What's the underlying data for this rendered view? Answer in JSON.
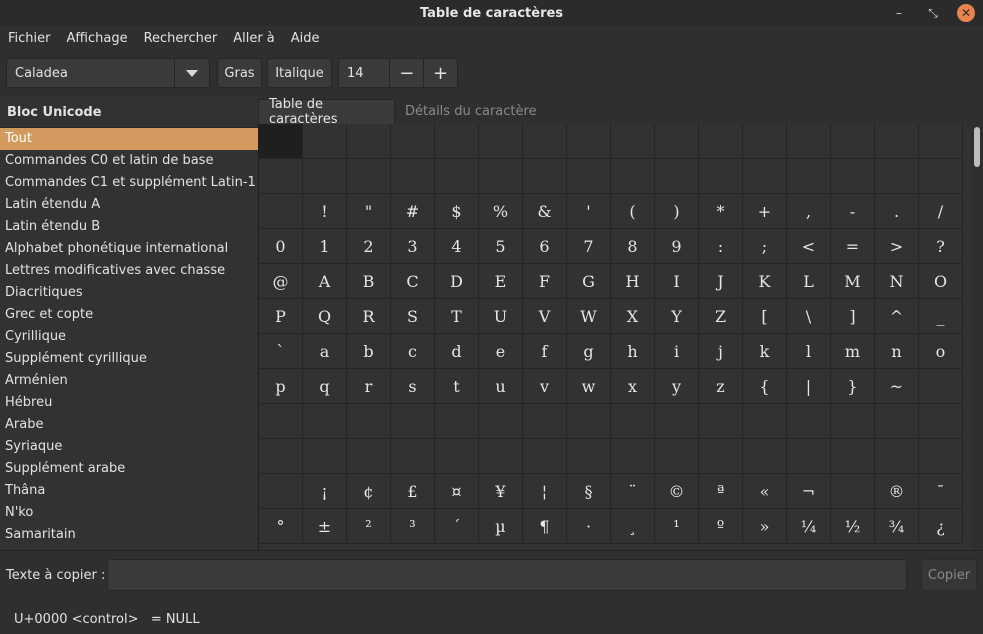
{
  "window": {
    "title": "Table de caractères"
  },
  "menu": [
    "Fichier",
    "Affichage",
    "Rechercher",
    "Aller à",
    "Aide"
  ],
  "toolbar": {
    "font": "Caladea",
    "bold_label": "Gras",
    "italic_label": "Italique",
    "size": "14",
    "minus_label": "−",
    "plus_label": "+"
  },
  "sidebar": {
    "header": "Bloc Unicode",
    "items": [
      "Tout",
      "Commandes C0 et latin de base",
      "Commandes C1 et supplément Latin-1",
      "Latin étendu A",
      "Latin étendu B",
      "Alphabet phonétique international",
      "Lettres modificatives avec chasse",
      "Diacritiques",
      "Grec et copte",
      "Cyrillique",
      "Supplément cyrillique",
      "Arménien",
      "Hébreu",
      "Arabe",
      "Syriaque",
      "Supplément arabe",
      "Thâna",
      "N'ko",
      "Samaritain"
    ],
    "selected_index": 0
  },
  "tabs": [
    "Table de caractères",
    "Détails du caractère"
  ],
  "grid": {
    "rows": [
      [
        "",
        "",
        "",
        "",
        "",
        "",
        "",
        "",
        "",
        "",
        "",
        "",
        "",
        "",
        "",
        ""
      ],
      [
        "",
        "",
        "",
        "",
        "",
        "",
        "",
        "",
        "",
        "",
        "",
        "",
        "",
        "",
        "",
        ""
      ],
      [
        "",
        "!",
        "\"",
        "#",
        "$",
        "%",
        "&",
        "'",
        "(",
        ")",
        "*",
        "+",
        ",",
        "-",
        ".",
        "/"
      ],
      [
        "0",
        "1",
        "2",
        "3",
        "4",
        "5",
        "6",
        "7",
        "8",
        "9",
        ":",
        ";",
        "<",
        "=",
        ">",
        "?"
      ],
      [
        "@",
        "A",
        "B",
        "C",
        "D",
        "E",
        "F",
        "G",
        "H",
        "I",
        "J",
        "K",
        "L",
        "M",
        "N",
        "O"
      ],
      [
        "P",
        "Q",
        "R",
        "S",
        "T",
        "U",
        "V",
        "W",
        "X",
        "Y",
        "Z",
        "[",
        "\\",
        "]",
        "^",
        "_"
      ],
      [
        "`",
        "a",
        "b",
        "c",
        "d",
        "e",
        "f",
        "g",
        "h",
        "i",
        "j",
        "k",
        "l",
        "m",
        "n",
        "o"
      ],
      [
        "p",
        "q",
        "r",
        "s",
        "t",
        "u",
        "v",
        "w",
        "x",
        "y",
        "z",
        "{",
        "|",
        "}",
        "~",
        ""
      ],
      [
        "",
        "",
        "",
        "",
        "",
        "",
        "",
        "",
        "",
        "",
        "",
        "",
        "",
        "",
        "",
        ""
      ],
      [
        "",
        "",
        "",
        "",
        "",
        "",
        "",
        "",
        "",
        "",
        "",
        "",
        "",
        "",
        "",
        ""
      ],
      [
        "",
        "¡",
        "¢",
        "£",
        "¤",
        "¥",
        "¦",
        "§",
        "¨",
        "©",
        "ª",
        "«",
        "¬",
        "",
        "®",
        "¯"
      ],
      [
        "°",
        "±",
        "²",
        "³",
        "´",
        "µ",
        "¶",
        "·",
        "¸",
        "¹",
        "º",
        "»",
        "¼",
        "½",
        "¾",
        "¿"
      ]
    ]
  },
  "copy": {
    "label": "Texte à copier :",
    "value": "",
    "button": "Copier"
  },
  "status": "U+0000 <control>   = NULL"
}
